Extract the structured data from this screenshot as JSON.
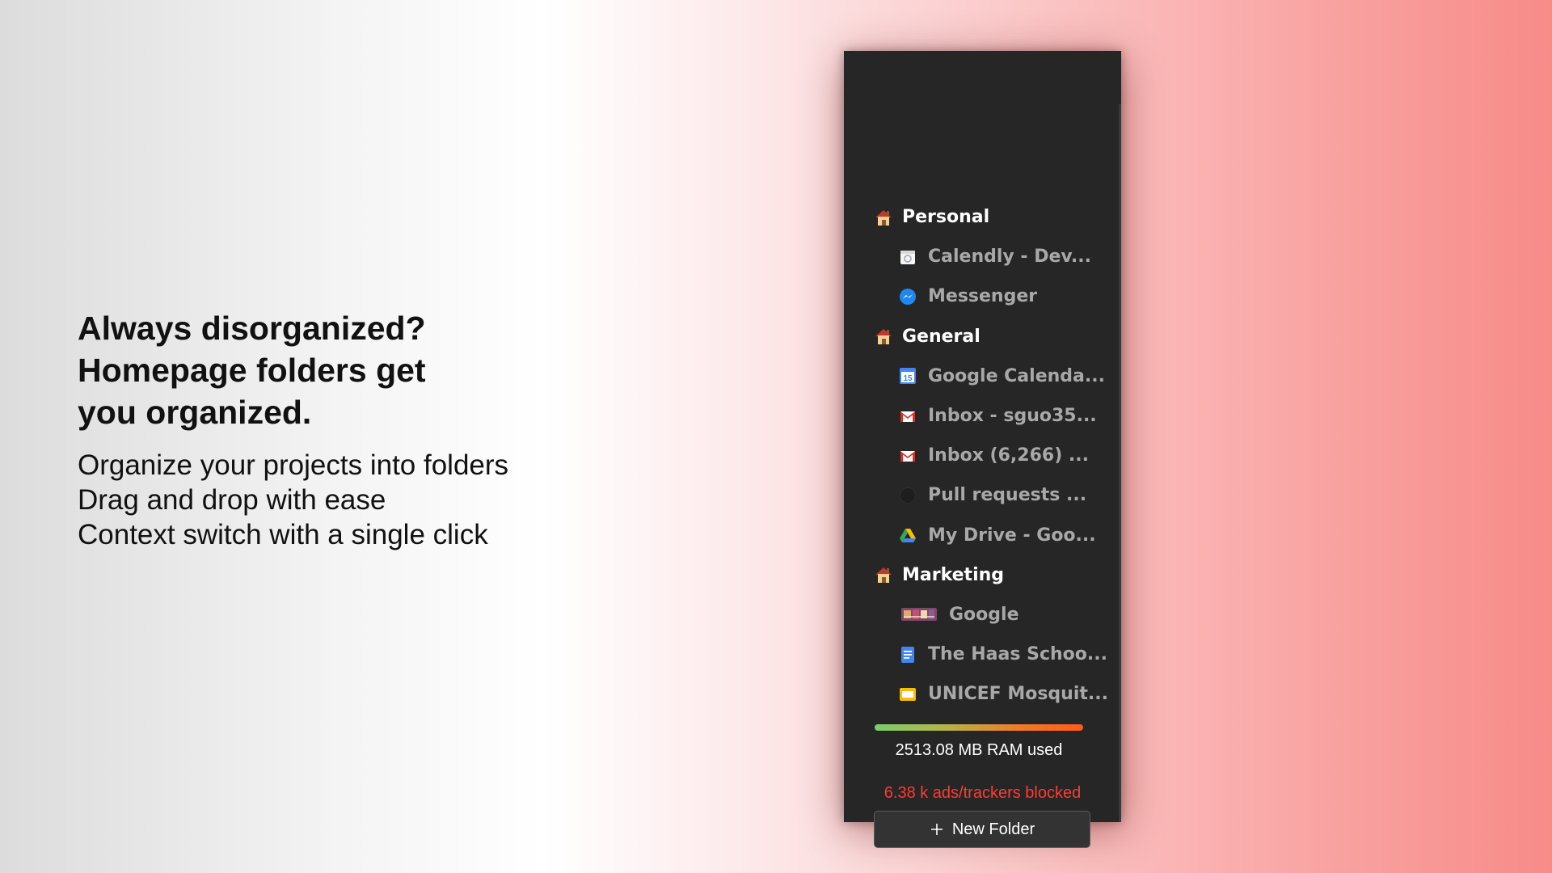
{
  "marketing": {
    "headline_lines": [
      "Always disorganized?",
      "Homepage folders get",
      "you organized."
    ],
    "bullets": [
      "Organize your projects into folders",
      "Drag and drop with ease",
      "Context switch with a single click"
    ]
  },
  "sidebar": {
    "folders": [
      {
        "label": "Personal",
        "icon": "house-icon",
        "tabs": [
          {
            "label": "Calendly - Dev...",
            "icon": "calendly-icon"
          },
          {
            "label": "Messenger",
            "icon": "messenger-icon"
          }
        ]
      },
      {
        "label": "General",
        "icon": "house-icon",
        "tabs": [
          {
            "label": "Google Calenda...",
            "icon": "google-calendar-icon",
            "icon_text": "15"
          },
          {
            "label": "Inbox - sguo35...",
            "icon": "gmail-icon"
          },
          {
            "label": "Inbox (6,266) ...",
            "icon": "gmail-icon"
          },
          {
            "label": "Pull requests ...",
            "icon": "github-icon"
          },
          {
            "label": "My Drive - Goo...",
            "icon": "google-drive-icon"
          }
        ]
      },
      {
        "label": "Marketing",
        "icon": "house-icon",
        "tabs": [
          {
            "label": "Google",
            "icon": "google-doodle-icon"
          },
          {
            "label": "The Haas Schoo...",
            "icon": "google-docs-icon"
          },
          {
            "label": "UNICEF Mosquit...",
            "icon": "google-slides-icon"
          }
        ]
      }
    ],
    "ram_text": "2513.08 MB RAM used",
    "blocked_text": "6.38 k ads/trackers blocked",
    "new_folder_label": "New Folder"
  },
  "colors": {
    "panel_bg": "#262626",
    "blocked_red": "#ff3b30",
    "folder_text": "#ffffff",
    "tab_text": "#a8a8a8"
  }
}
